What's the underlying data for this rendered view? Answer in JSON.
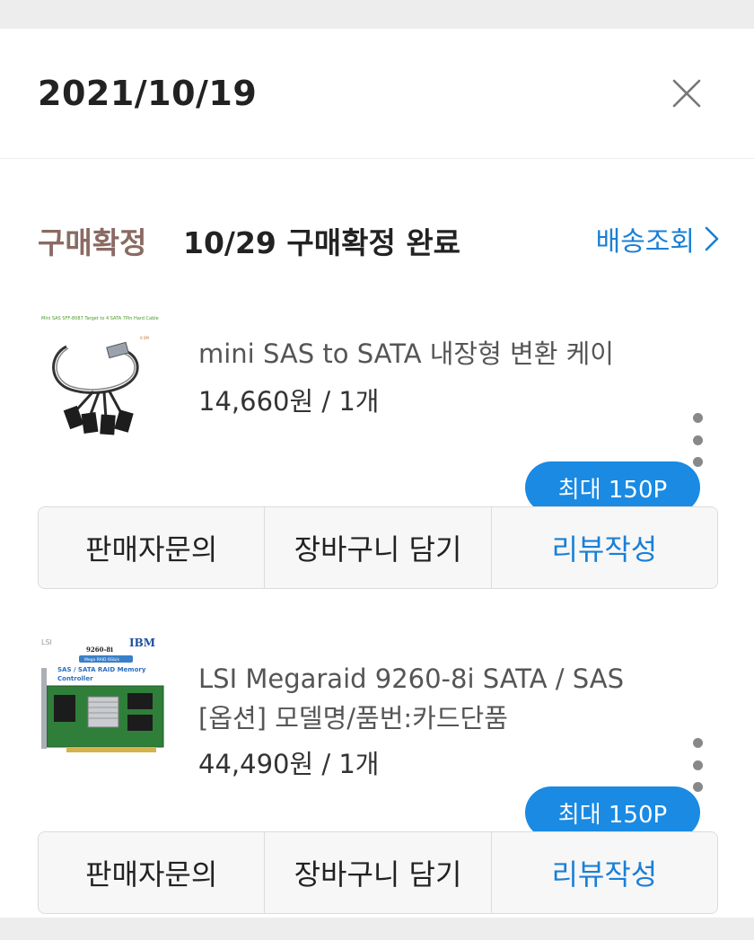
{
  "header": {
    "date": "2021/10/19",
    "close_icon": "close-icon"
  },
  "status": {
    "label": "구매확정",
    "text": "10/29 구매확정 완료",
    "tracking_label": "배송조회",
    "tracking_icon": "chevron-right-icon"
  },
  "items": [
    {
      "name_line1": "mini SAS to SATA 내장형 변환 케이",
      "name_line2": "",
      "price": "14,660원 / 1개",
      "thumb_caption": "Mini SAS SFF-8087 Target to 4 SATA 7Pin Hard Cable",
      "points": "최대 150P",
      "buttons": {
        "inquiry": "판매자문의",
        "cart": "장바구니 담기",
        "review": "리뷰작성"
      }
    },
    {
      "name_line1": "LSI Megaraid 9260-8i SATA / SAS",
      "name_line2": "[옵션] 모델명/품번:카드단품",
      "price": "44,490원 / 1개",
      "thumb_brand_left": "LSI",
      "thumb_brand_right": "IBM",
      "thumb_model": "9260-8i",
      "thumb_badge": "Mega RAID 6Gb/s",
      "thumb_title1": "SAS / SATA RAID Memory",
      "thumb_title2": "Controller",
      "points": "최대 150P",
      "buttons": {
        "inquiry": "판매자문의",
        "cart": "장바구니 담기",
        "review": "리뷰작성"
      }
    }
  ],
  "colors": {
    "accent": "#1a7fd6",
    "bubble": "#1a8ae3",
    "status_label": "#8a6a63",
    "background": "#ededed"
  }
}
